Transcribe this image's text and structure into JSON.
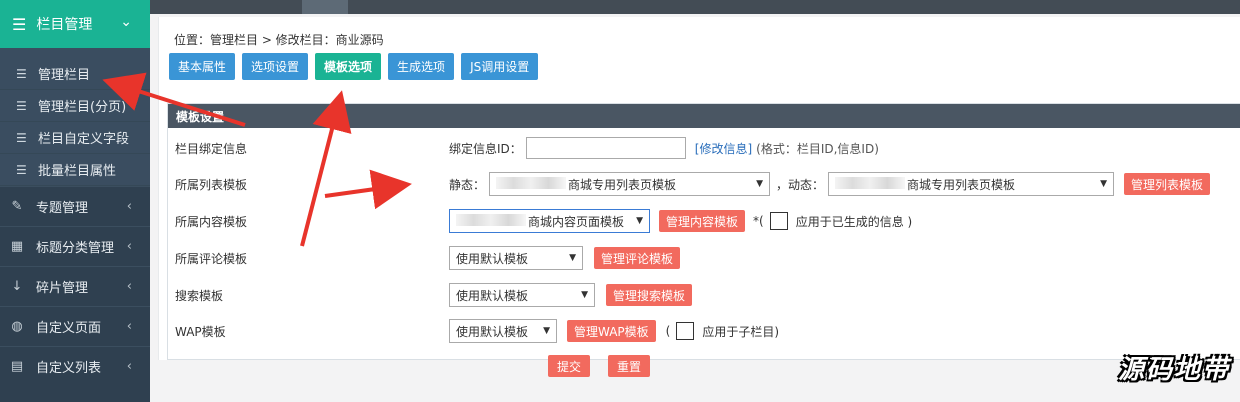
{
  "sidebar": {
    "header": {
      "label": "栏目管理",
      "icon": "menu-icon"
    },
    "sub_items": [
      {
        "label": "管理栏目"
      },
      {
        "label": "管理栏目(分页)"
      },
      {
        "label": "栏目自定义字段"
      },
      {
        "label": "批量栏目属性"
      }
    ],
    "groups": [
      {
        "label": "专题管理",
        "icon": "edit-icon"
      },
      {
        "label": "标题分类管理",
        "icon": "grid-icon"
      },
      {
        "label": "碎片管理",
        "icon": "sort-numeric-icon"
      },
      {
        "label": "自定义页面",
        "icon": "compass-icon"
      },
      {
        "label": "自定义列表",
        "icon": "table-icon"
      }
    ]
  },
  "breadcrumb": "位置：管理栏目 > 修改栏目：商业源码",
  "tabs": [
    "基本属性",
    "选项设置",
    "模板选项",
    "生成选项",
    "JS调用设置"
  ],
  "panel": {
    "title": "模板设置",
    "rows": {
      "bind": {
        "label": "栏目绑定信息",
        "field_label": "绑定信息ID：",
        "link": "[修改信息]",
        "hint": "(格式：栏目ID,信息ID)"
      },
      "list": {
        "label": "所属列表模板",
        "static_label": "静态：",
        "static_value": "商城专用列表页模板",
        "dynamic_label": "，动态：",
        "dynamic_value": "商城专用列表页模板",
        "manage_button": "管理列表模板"
      },
      "content": {
        "label": "所属内容模板",
        "value": "商城内容页面模板",
        "manage_button": "管理内容模板",
        "prefix": "*(",
        "checkbox_label": "应用于已生成的信息 )"
      },
      "comment": {
        "label": "所属评论模板",
        "value": "使用默认模板",
        "manage_button": "管理评论模板"
      },
      "search": {
        "label": "搜索模板",
        "value": "使用默认模板",
        "manage_button": "管理搜索模板"
      },
      "wap": {
        "label": "WAP模板",
        "value": "使用默认模板",
        "manage_button": "管理WAP模板",
        "prefix": "(",
        "checkbox_label": "应用于子栏目)"
      }
    }
  },
  "actions": {
    "submit": "提交",
    "reset": "重置"
  },
  "watermark": "源码地带",
  "colors": {
    "accent": "#1ab394",
    "tab_blue": "#3a95d6",
    "button_red": "#f26a5e",
    "sidebar_bg": "#2f4050",
    "arrow_red": "#e8342b"
  }
}
